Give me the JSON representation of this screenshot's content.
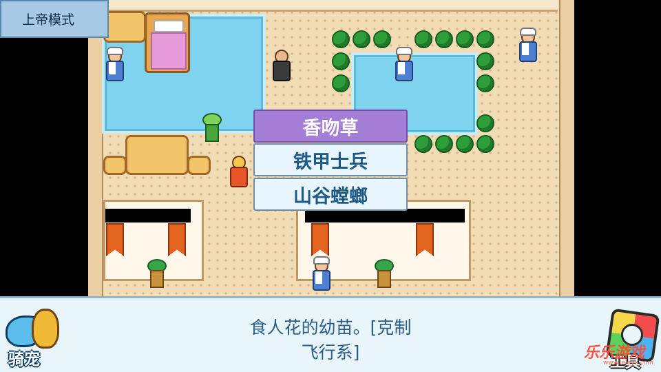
{
  "hud": {
    "god_mode_label": "上帝模式"
  },
  "monster_menu": {
    "items": [
      {
        "label": "香吻草",
        "selected": true
      },
      {
        "label": "铁甲士兵",
        "selected": false
      },
      {
        "label": "山谷螳螂",
        "selected": false
      }
    ]
  },
  "dialog": {
    "line1": "食人花的幼苗。[克制",
    "line2": "飞行系]"
  },
  "buttons": {
    "ride_label": "骑宠",
    "tools_label": "工具"
  },
  "watermark": {
    "text": "乐乐游戏",
    "sub": "www.leleyx.com"
  },
  "colors": {
    "selected_item": "#a37dd6",
    "menu_item": "#eaf6ff",
    "dialog_bg": "#e8f6fb",
    "dialog_text": "#2a5b8c"
  }
}
